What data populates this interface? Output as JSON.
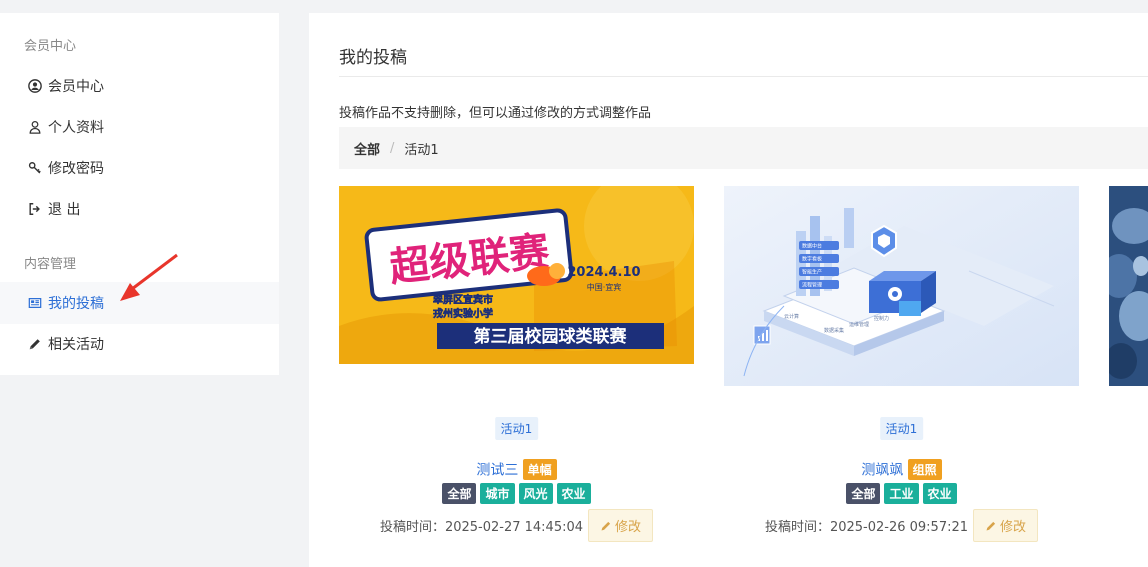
{
  "sidebar": {
    "section_member": "会员中心",
    "section_content": "内容管理",
    "items": [
      {
        "label": "会员中心",
        "icon": "user-circle-icon"
      },
      {
        "label": "个人资料",
        "icon": "user-icon"
      },
      {
        "label": "修改密码",
        "icon": "key-icon"
      },
      {
        "label": "退 出",
        "icon": "sign-out-icon"
      },
      {
        "label": "我的投稿",
        "icon": "newspaper-icon",
        "active": true
      },
      {
        "label": "相关活动",
        "icon": "pencil-icon"
      }
    ]
  },
  "main": {
    "title": "我的投稿",
    "notice": "投稿作品不支持删除，但可以通过修改的方式调整作品",
    "breadcrumb": {
      "all": "全部",
      "separator": "/",
      "current": "活动1"
    }
  },
  "banner": {
    "headline": "超级联赛",
    "date": "2024.4.10",
    "place": "中国·宜宾",
    "org_line1": "翠屏区宜宾市",
    "org_line2": "戎州实验小学",
    "event": "第三届校园球类联赛"
  },
  "iso_illustration": {
    "labels": [
      "数据中台",
      "数字看板",
      "智能生产",
      "流程管理",
      "数据采集",
      "运维管理",
      "控制力",
      "云计算"
    ]
  },
  "cards": [
    {
      "activity": "活动1",
      "name": "测试三",
      "type_badge": "单幅",
      "categories": [
        "全部",
        "城市",
        "风光",
        "农业"
      ],
      "time": "投稿时间：2025-02-27 14:45:04",
      "edit_label": "修改"
    },
    {
      "activity": "活动1",
      "name": "测飒飒",
      "type_badge": "组照",
      "categories": [
        "全部",
        "工业",
        "农业"
      ],
      "time": "投稿时间：2025-02-26 09:57:21",
      "edit_label": "修改"
    }
  ],
  "colors": {
    "accent": "#2d6fd6",
    "badge_orange": "#f0a020",
    "badge_dark": "#4a5168",
    "badge_teal": "#1aaf9b",
    "arrow": "#e8352b"
  }
}
